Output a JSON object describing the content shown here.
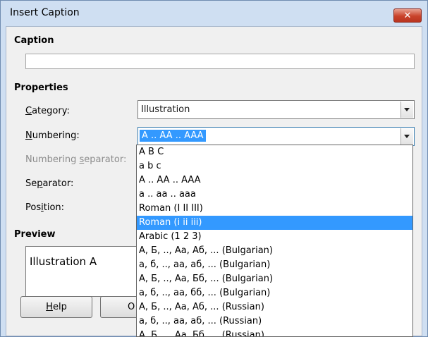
{
  "window": {
    "title": "Insert Caption",
    "close_glyph": "✕"
  },
  "caption": {
    "section_label": "Caption",
    "input_value": ""
  },
  "properties": {
    "section_label": "Properties",
    "category": {
      "label": "Category:",
      "mnemonic": "C",
      "rest": "ategory:",
      "value": "Illustration"
    },
    "numbering": {
      "label": "Numbering:",
      "mnemonic": "N",
      "rest": "umbering:",
      "value": "A .. AA .. AAA"
    },
    "numbering_separator": {
      "label": "Numbering separator:",
      "mnemonic": "s",
      "before": "Numbering ",
      "rest": "eparator:"
    },
    "separator": {
      "label": "Separator:",
      "before": "Se",
      "mnemonic": "p",
      "rest": "arator:"
    },
    "position": {
      "label": "Position:",
      "before": "Pos",
      "mnemonic": "i",
      "rest": "tion:"
    }
  },
  "preview": {
    "section_label": "Preview",
    "text": "Illustration A"
  },
  "buttons": {
    "help": {
      "label": "Help",
      "mnemonic": "H",
      "rest": "elp"
    },
    "ok": {
      "label": "OK",
      "visible": "O"
    }
  },
  "numbering_dropdown": {
    "selected_index": 5,
    "options": [
      "A B C",
      "a b c",
      "A .. AA .. AAA",
      "a .. aa .. aaa",
      "Roman (I II III)",
      "Roman (i ii iii)",
      "Arabic (1 2 3)",
      "А, Б, .., Аа, Аб, ... (Bulgarian)",
      "а, б, .., аа, аб, ... (Bulgarian)",
      "А, Б, .., Аа, Бб, ... (Bulgarian)",
      "а, б, .., аа, бб, ... (Bulgarian)",
      "А, Б, .., Аа, Аб, ... (Russian)",
      "а, б, .., аа, аб, ... (Russian)",
      "А, Б, .., Аа, Бб, ... (Russian)"
    ]
  },
  "colors": {
    "selection": "#3399ff",
    "titlebar": "#cfdff2",
    "close": "#c9432b"
  }
}
